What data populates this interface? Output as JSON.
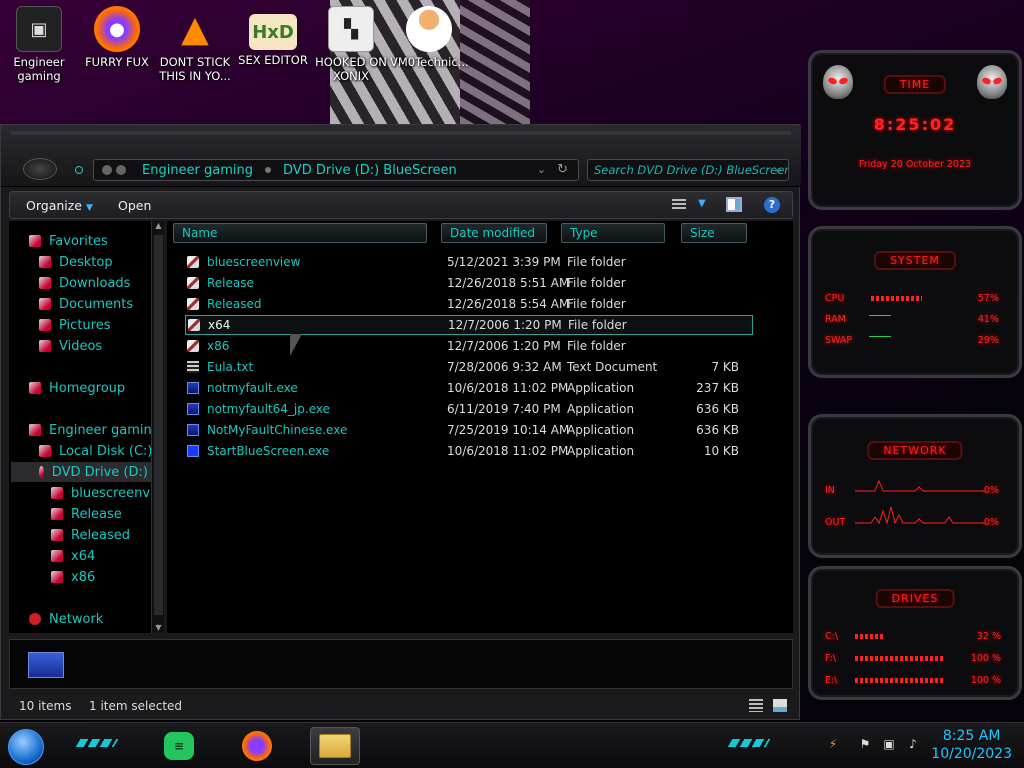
{
  "desktop": {
    "icons": [
      {
        "label": "Engineer\ngaming",
        "icon": "computer-icon"
      },
      {
        "label": "FURRY FUX",
        "icon": "firefox-icon"
      },
      {
        "label": "DONT STICK\nTHIS IN YO...",
        "icon": "vlc-icon"
      },
      {
        "label": "SEX EDITOR",
        "icon": "hxd-icon"
      },
      {
        "label": "HOOKED ON\nXONIX",
        "icon": "game-icon"
      },
      {
        "label": "VM0Technic...",
        "icon": "doctor-icon"
      }
    ]
  },
  "explorer": {
    "address": {
      "root": "Engineer gaming",
      "path": "DVD Drive (D:) BlueScreen"
    },
    "search_placeholder": "Search DVD Drive (D:) BlueScreen",
    "toolbar": {
      "organize": "Organize",
      "open": "Open"
    },
    "nav": {
      "favorites": "Favorites",
      "desktop": "Desktop",
      "downloads": "Downloads",
      "documents": "Documents",
      "pictures": "Pictures",
      "videos": "Videos",
      "homegroup": "Homegroup",
      "computer": "Engineer gaming",
      "local_disk": "Local Disk (C:)",
      "dvd_drive": "DVD Drive (D:) B",
      "sub_bluescreenview": "bluescreenview",
      "sub_release": "Release",
      "sub_released": "Released",
      "sub_x64": "x64",
      "sub_x86": "x86",
      "network": "Network"
    },
    "columns": {
      "name": "Name",
      "date": "Date modified",
      "type": "Type",
      "size": "Size"
    },
    "files": [
      {
        "name": "bluescreenview",
        "date": "5/12/2021 3:39 PM",
        "type": "File folder",
        "size": "",
        "kind": "folder"
      },
      {
        "name": "Release",
        "date": "12/26/2018 5:51 AM",
        "type": "File folder",
        "size": "",
        "kind": "folder"
      },
      {
        "name": "Released",
        "date": "12/26/2018 5:54 AM",
        "type": "File folder",
        "size": "",
        "kind": "folder"
      },
      {
        "name": "x64",
        "date": "12/7/2006 1:20 PM",
        "type": "File folder",
        "size": "",
        "kind": "folder"
      },
      {
        "name": "x86",
        "date": "12/7/2006 1:20 PM",
        "type": "File folder",
        "size": "",
        "kind": "folder"
      },
      {
        "name": "Eula.txt",
        "date": "7/28/2006 9:32 AM",
        "type": "Text Document",
        "size": "7 KB",
        "kind": "text"
      },
      {
        "name": "notmyfault.exe",
        "date": "10/6/2018 11:02 PM",
        "type": "Application",
        "size": "237 KB",
        "kind": "exe"
      },
      {
        "name": "notmyfault64_jp.exe",
        "date": "6/11/2019 7:40 PM",
        "type": "Application",
        "size": "636 KB",
        "kind": "exe"
      },
      {
        "name": "NotMyFaultChinese.exe",
        "date": "7/25/2019 10:14 AM",
        "type": "Application",
        "size": "636 KB",
        "kind": "exe"
      },
      {
        "name": "StartBlueScreen.exe",
        "date": "10/6/2018 11:02 PM",
        "type": "Application",
        "size": "10 KB",
        "kind": "exe"
      }
    ],
    "selected_index": 3,
    "status": {
      "items": "10 items",
      "selected": "1 item selected"
    }
  },
  "gadgets": {
    "time": {
      "title": "TIME",
      "clock": "8:25:02",
      "date": "Friday 20 October 2023"
    },
    "system": {
      "title": "SYSTEM",
      "rows": [
        {
          "label": "CPU",
          "value": "57%",
          "level": 0.57
        },
        {
          "label": "RAM",
          "value": "41%",
          "level": 0.41
        },
        {
          "label": "SWAP",
          "value": "29%",
          "level": 0.29
        }
      ]
    },
    "network": {
      "title": "NETWORK",
      "rows": [
        {
          "label": "IN",
          "value": "0%"
        },
        {
          "label": "OUT",
          "value": "0%"
        }
      ]
    },
    "drives": {
      "title": "DRIVES",
      "rows": [
        {
          "label": "C:\\",
          "value": "32 %",
          "level": 0.32
        },
        {
          "label": "F:\\",
          "value": "100 %",
          "level": 1.0
        },
        {
          "label": "E:\\",
          "value": "100 %",
          "level": 1.0
        }
      ]
    }
  },
  "taskbar": {
    "time": "8:25 AM",
    "date": "10/20/2023",
    "accent": "#13c9d6"
  }
}
